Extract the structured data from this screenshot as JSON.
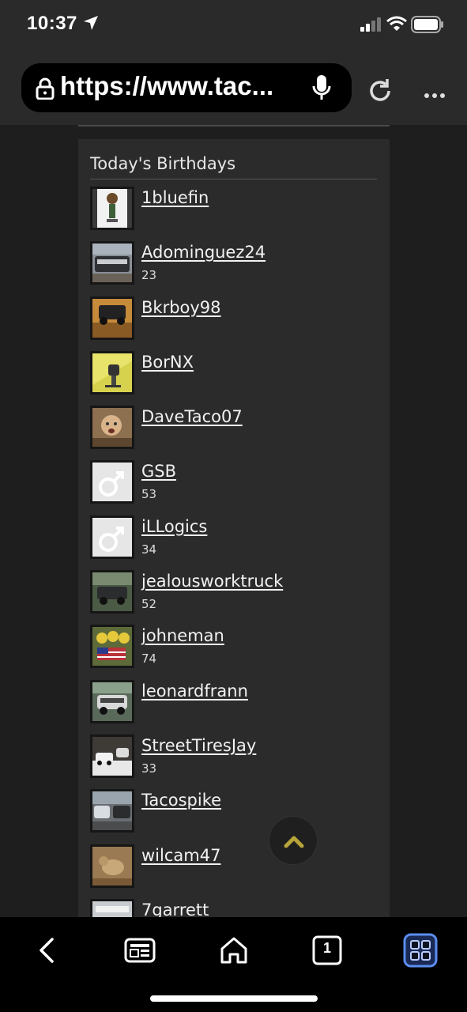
{
  "status_bar": {
    "time": "10:37"
  },
  "browser": {
    "url": "https://www.tac..."
  },
  "section": {
    "title": "Today's Birthdays"
  },
  "birthdays": [
    {
      "name": "1bluefin",
      "age": ""
    },
    {
      "name": "Adominguez24",
      "age": "23"
    },
    {
      "name": "Bkrboy98",
      "age": ""
    },
    {
      "name": "BorNX",
      "age": ""
    },
    {
      "name": "DaveTaco07",
      "age": ""
    },
    {
      "name": "GSB",
      "age": "53"
    },
    {
      "name": "iLLogics",
      "age": "34"
    },
    {
      "name": "jealousworktruck",
      "age": "52"
    },
    {
      "name": "johneman",
      "age": "74"
    },
    {
      "name": "leonardfrann",
      "age": ""
    },
    {
      "name": "StreetTiresJay",
      "age": "33"
    },
    {
      "name": "Tacospike",
      "age": ""
    },
    {
      "name": "wilcam47",
      "age": ""
    },
    {
      "name": "7garrett",
      "age": ""
    }
  ],
  "toolbar": {
    "tab_count": "1"
  },
  "icons": {
    "accent": "#5b8def",
    "scroll_top_arrow": "#b7a43a"
  }
}
